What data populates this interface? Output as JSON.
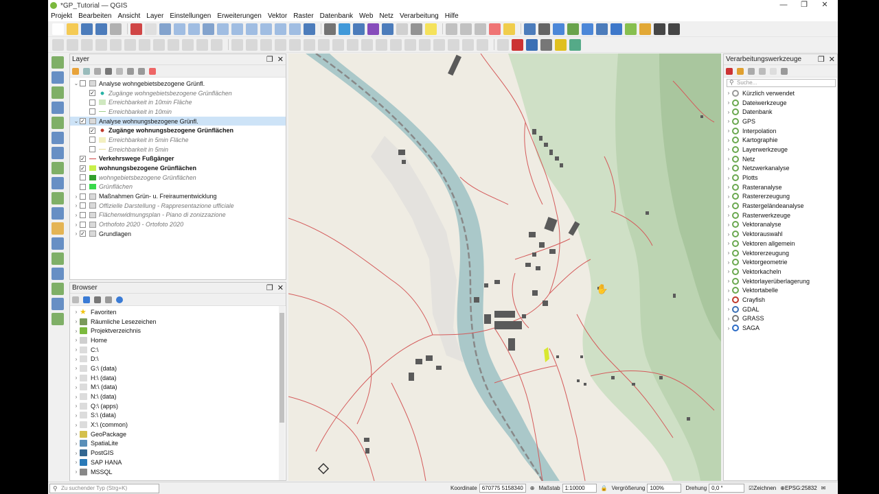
{
  "window": {
    "title": "*GP_Tutorial — QGIS",
    "controls": [
      "—",
      "❐",
      "✕"
    ]
  },
  "menu": [
    "Projekt",
    "Bearbeiten",
    "Ansicht",
    "Layer",
    "Einstellungen",
    "Erweiterungen",
    "Vektor",
    "Raster",
    "Datenbank",
    "Web",
    "Netz",
    "Verarbeitung",
    "Hilfe"
  ],
  "layers_panel": {
    "title": "Layer",
    "items": [
      {
        "label": "Analyse wohngebietsbezogene Grünfl.",
        "depth": 0,
        "expanded": true,
        "checked": false,
        "style": "normal",
        "icon": "group",
        "selected": false
      },
      {
        "label": "Zugänge wohngebietsbezogene Grünflächen",
        "depth": 1,
        "checked": true,
        "style": "italic",
        "icon": "point",
        "color": "#2ab3a6",
        "selected": false
      },
      {
        "label": "Erreichbarkeit in 10min Fläche",
        "depth": 1,
        "checked": false,
        "style": "italic",
        "icon": "fill",
        "color": "#cfe8c0",
        "selected": false
      },
      {
        "label": "Erreichbarkeit in 10min",
        "depth": 1,
        "checked": false,
        "style": "italic",
        "icon": "line",
        "color": "#9ecf8a",
        "selected": false
      },
      {
        "label": "Analyse wohnungsbezogene Grünfl.",
        "depth": 0,
        "expanded": true,
        "checked": true,
        "style": "normal",
        "icon": "group",
        "selected": true
      },
      {
        "label": "Zugänge wohnungsbezogene Grünflächen",
        "depth": 1,
        "checked": true,
        "style": "bold",
        "icon": "point",
        "color": "#c0392b",
        "selected": false
      },
      {
        "label": "Erreichbarkeit in 5min Fläche",
        "depth": 1,
        "checked": false,
        "style": "italic",
        "icon": "fill",
        "color": "#f3f0c0",
        "selected": false
      },
      {
        "label": "Erreichbarkeit in 5min",
        "depth": 1,
        "checked": false,
        "style": "italic",
        "icon": "line",
        "color": "#e8df95",
        "selected": false
      },
      {
        "label": "Verkehrswege Fußgänger",
        "depth": 0,
        "checked": true,
        "style": "bold",
        "icon": "line",
        "color": "#c44",
        "selected": false
      },
      {
        "label": "wohnungsbezogene Grünflächen",
        "depth": 0,
        "checked": true,
        "style": "bold",
        "icon": "fill",
        "color": "#c8f04a",
        "selected": false
      },
      {
        "label": "wohngebietsbezogene Grünflächen",
        "depth": 0,
        "checked": false,
        "style": "italic",
        "icon": "fill",
        "color": "#33a02c",
        "selected": false
      },
      {
        "label": "Grünflächen",
        "depth": 0,
        "checked": false,
        "style": "italic",
        "icon": "fill",
        "color": "#38d94a",
        "selected": false
      },
      {
        "label": "Maßnahmen Grün- u. Freiraumentwicklung",
        "depth": 0,
        "expanded": false,
        "checked": false,
        "style": "normal",
        "icon": "group",
        "selected": false
      },
      {
        "label": "Offizielle Darstellung - Rappresentazione ufficiale",
        "depth": 0,
        "expanded": false,
        "checked": false,
        "style": "italic",
        "icon": "group",
        "selected": false
      },
      {
        "label": "Flächenwidmungsplan - Piano di zonizzazione",
        "depth": 0,
        "expanded": false,
        "checked": false,
        "style": "italic",
        "icon": "group",
        "selected": false
      },
      {
        "label": "Orthofoto 2020 - Ortofoto 2020",
        "depth": 0,
        "expanded": false,
        "checked": false,
        "style": "italic",
        "icon": "group",
        "selected": false
      },
      {
        "label": "Grundlagen",
        "depth": 0,
        "expanded": false,
        "checked": true,
        "style": "normal",
        "icon": "group",
        "selected": false
      }
    ]
  },
  "browser_panel": {
    "title": "Browser",
    "items": [
      {
        "label": "Favoriten",
        "icon": "star",
        "color": "#f1c40f"
      },
      {
        "label": "Räumliche Lesezeichen",
        "icon": "bookmark",
        "color": "#7a9a5a"
      },
      {
        "label": "Projektverzeichnis",
        "icon": "folder",
        "color": "#7bb93d"
      },
      {
        "label": "Home",
        "icon": "folder",
        "color": "#cfcfcf"
      },
      {
        "label": "C:\\",
        "icon": "drive",
        "color": "#dcdcdc"
      },
      {
        "label": "D:\\",
        "icon": "drive",
        "color": "#dcdcdc"
      },
      {
        "label": "G:\\ (data)",
        "icon": "drive",
        "color": "#dcdcdc"
      },
      {
        "label": "H:\\ (data)",
        "icon": "drive",
        "color": "#dcdcdc"
      },
      {
        "label": "M:\\ (data)",
        "icon": "drive",
        "color": "#dcdcdc"
      },
      {
        "label": "N:\\ (data)",
        "icon": "drive",
        "color": "#dcdcdc"
      },
      {
        "label": "Q:\\ (apps)",
        "icon": "drive",
        "color": "#dcdcdc"
      },
      {
        "label": "S:\\ (data)",
        "icon": "drive",
        "color": "#dcdcdc"
      },
      {
        "label": "X:\\ (common)",
        "icon": "drive",
        "color": "#dcdcdc"
      },
      {
        "label": "GeoPackage",
        "icon": "geopackage",
        "color": "#d4c04c"
      },
      {
        "label": "SpatiaLite",
        "icon": "feather",
        "color": "#5a8fb8"
      },
      {
        "label": "PostGIS",
        "icon": "elephant",
        "color": "#336791"
      },
      {
        "label": "SAP HANA",
        "icon": "database",
        "color": "#2a7ab8"
      },
      {
        "label": "MSSQL",
        "icon": "database",
        "color": "#888"
      }
    ]
  },
  "processing_panel": {
    "title": "Verarbeitungswerkzeuge",
    "search_placeholder": "Suche...",
    "items": [
      {
        "label": "Kürzlich verwendet",
        "icon": "clock"
      },
      {
        "label": "Dateiwerkzeuge",
        "icon": "qgis"
      },
      {
        "label": "Datenbank",
        "icon": "qgis"
      },
      {
        "label": "GPS",
        "icon": "qgis"
      },
      {
        "label": "Interpolation",
        "icon": "qgis"
      },
      {
        "label": "Kartographie",
        "icon": "qgis"
      },
      {
        "label": "Layerwerkzeuge",
        "icon": "qgis"
      },
      {
        "label": "Netz",
        "icon": "qgis"
      },
      {
        "label": "Netzwerkanalyse",
        "icon": "qgis"
      },
      {
        "label": "Plotts",
        "icon": "qgis"
      },
      {
        "label": "Rasteranalyse",
        "icon": "qgis"
      },
      {
        "label": "Rastererzeugung",
        "icon": "qgis"
      },
      {
        "label": "Rastergeländeanalyse",
        "icon": "qgis"
      },
      {
        "label": "Rasterwerkzeuge",
        "icon": "qgis"
      },
      {
        "label": "Vektoranalyse",
        "icon": "qgis"
      },
      {
        "label": "Vektorauswahl",
        "icon": "qgis"
      },
      {
        "label": "Vektoren allgemein",
        "icon": "qgis"
      },
      {
        "label": "Vektorerzeugung",
        "icon": "qgis"
      },
      {
        "label": "Vektorgeometrie",
        "icon": "qgis"
      },
      {
        "label": "Vektorkacheln",
        "icon": "qgis"
      },
      {
        "label": "Vektorlayerüberlagerung",
        "icon": "qgis"
      },
      {
        "label": "Vektortabelle",
        "icon": "qgis"
      },
      {
        "label": "Crayfish",
        "icon": "crayfish"
      },
      {
        "label": "GDAL",
        "icon": "gdal"
      },
      {
        "label": "GRASS",
        "icon": "grass"
      },
      {
        "label": "SAGA",
        "icon": "saga"
      }
    ]
  },
  "statusbar": {
    "locator_placeholder": "Zu suchender Typ (Strg+K)",
    "coord_label": "Koordinate",
    "coord_value": "670775 5158340",
    "scale_label": "Maßstab",
    "scale_value": "1:10000",
    "magnifier_label": "Vergrößerung",
    "magnifier_value": "100%",
    "rotation_label": "Drehung",
    "rotation_value": "0,0 °",
    "render_label": "Zeichnen",
    "crs_label": "EPSG:25832"
  },
  "colors": {
    "map_background": "#efece3",
    "terrain": "#cfe0c6",
    "river": "#aac8c9",
    "roads": "#d45a5a",
    "buildings": "#5a5a5a",
    "selection": "#cde3f7"
  }
}
